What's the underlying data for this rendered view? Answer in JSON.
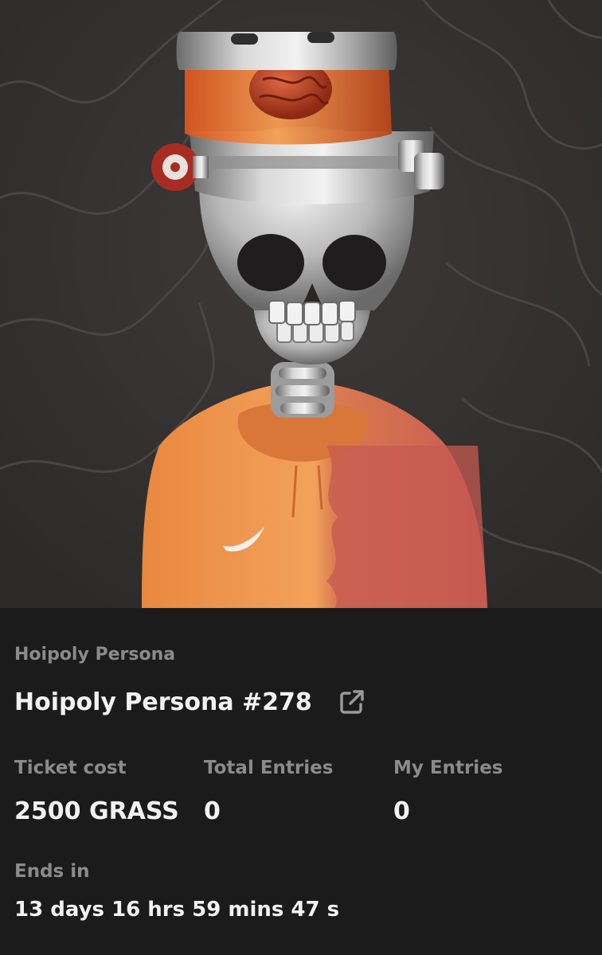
{
  "nft": {
    "image_alt": "Hoipoly Persona #278",
    "collection": "Hoipoly Persona",
    "title": "Hoipoly Persona #278",
    "external_link_icon": "external-link-icon"
  },
  "stats": {
    "ticket_cost_label": "Ticket cost",
    "ticket_cost_value": "2500 GRASS",
    "total_entries_label": "Total Entries",
    "total_entries_value": "0",
    "my_entries_label": "My Entries",
    "my_entries_value": "0"
  },
  "countdown": {
    "label": "Ends in",
    "value": "13 days 16 hrs 59 mins 47 s"
  },
  "colors": {
    "card_background": "#1b1b1b",
    "artwork_background": "#353232",
    "label_text": "#8b8b8b",
    "value_text": "#f2f2f2"
  }
}
